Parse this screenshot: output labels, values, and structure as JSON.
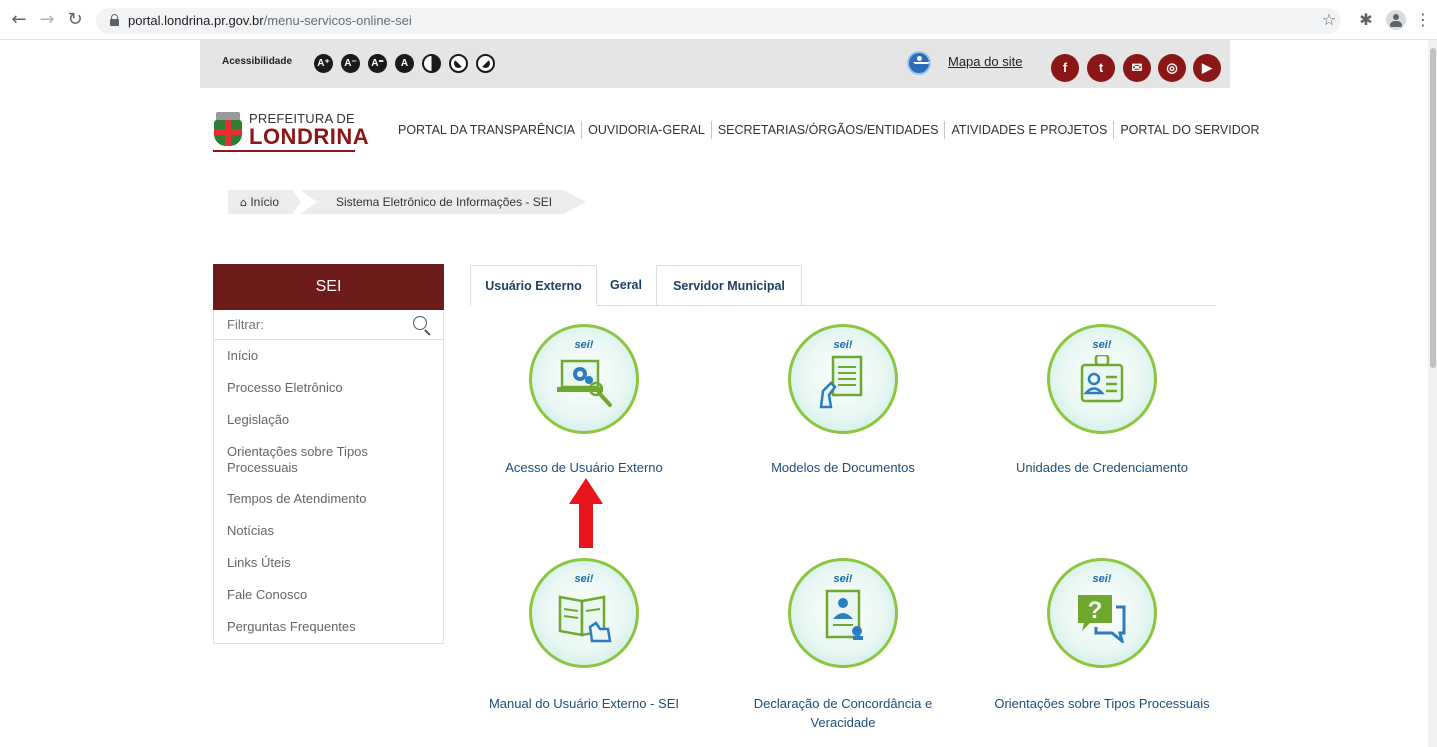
{
  "browser": {
    "url_host": "portal.londrina.pr.gov.br",
    "url_path": "/menu-servicos-online-sei"
  },
  "access_bar": {
    "label": "Acessibilidade",
    "buttons": [
      "A+",
      "A-",
      "A=",
      "A",
      "contrast",
      "dark",
      "light"
    ],
    "site_map": "Mapa do site",
    "social": [
      "f",
      "t",
      "m",
      "ig",
      "yt"
    ],
    "social_color": "#8b1616"
  },
  "header": {
    "logo_top": "PREFEITURA DE",
    "logo_main": "LONDRINA",
    "nav": [
      "PORTAL DA TRANSPARÊNCIA",
      "OUVIDORIA-GERAL",
      "SECRETARIAS/ÓRGÃOS/ENTIDADES",
      "ATIVIDADES E PROJETOS",
      "PORTAL DO SERVIDOR"
    ]
  },
  "breadcrumb": {
    "home": "Início",
    "current": "Sistema Eletrônico de Informações - SEI"
  },
  "sidebar": {
    "title": "SEI",
    "filter_placeholder": "Filtrar:",
    "items": [
      "Início",
      "Processo Eletrônico",
      "Legislação",
      "Orientações sobre Tipos Processuais",
      "Tempos de Atendimento",
      "Notícias",
      "Links Úteis",
      "Fale Conosco",
      "Perguntas Frequentes"
    ]
  },
  "tabs": [
    "Usuário Externo",
    "Geral",
    "Servidor Municipal"
  ],
  "services": {
    "sei_tag": "sei!",
    "items": [
      {
        "label": "Acesso de Usuário Externo",
        "icon": "laptop-gear-icon"
      },
      {
        "label": "Modelos de Documentos",
        "icon": "document-hand-icon"
      },
      {
        "label": "Unidades de Credenciamento",
        "icon": "id-badge-icon"
      },
      {
        "label": "Manual do Usuário Externo - SEI",
        "icon": "book-hand-icon"
      },
      {
        "label": "Declaração de Concordância e Veracidade",
        "icon": "certificate-icon"
      },
      {
        "label": "Orientações sobre Tipos Processuais",
        "icon": "question-chat-icon"
      }
    ]
  },
  "colors": {
    "brand": "#6e1b1b",
    "circle_border": "#8cc63f",
    "link": "#1f4e79",
    "arrow": "#e8141b"
  }
}
